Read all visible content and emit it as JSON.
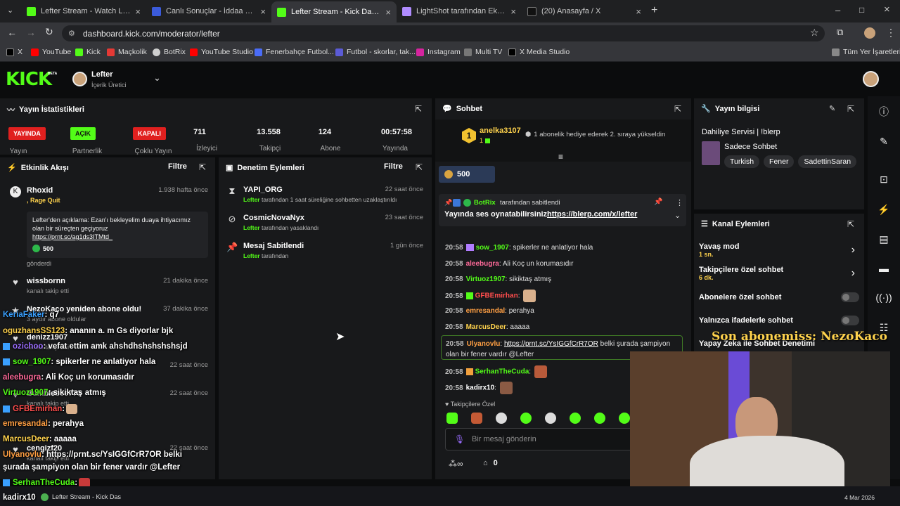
{
  "browser": {
    "tabs": [
      {
        "label": "Lefter Stream - Watch Live on Kick",
        "color": "#53fc18"
      },
      {
        "label": "Canlı Sonuçlar - İddaa Sonuçları",
        "color": "#3b5bdb"
      },
      {
        "label": "Lefter Stream - Kick Dashboard",
        "color": "#53fc18"
      },
      {
        "label": "LightShot tarafından Ekran Görüntüsü",
        "color": "#b08cff"
      },
      {
        "label": "(20) Anasayfa / X",
        "color": "#ffffff"
      }
    ],
    "url": "dashboard.kick.com/moderator/lefter",
    "bookmarks": [
      "X",
      "YouTube",
      "Kick",
      "Maçkolik",
      "BotRix",
      "YouTube Studio",
      "Fenerbahçe Futbol...",
      "Futbol - skorlar, tak...",
      "Instagram",
      "Multi TV",
      "X Media Studio"
    ],
    "all_bookmarks": "Tüm Yer İşaretleri"
  },
  "header": {
    "logo": "KICK",
    "logo_badge": "BETA",
    "user_name": "Lefter",
    "user_role": "İçerik Üretici"
  },
  "stats": {
    "title": "Yayın İstatistikleri",
    "pills": [
      {
        "label": "YAYINDA",
        "sub": "Yayın",
        "color": "#e0201f"
      },
      {
        "label": "AÇIK",
        "sub": "Partnerlik",
        "color": "#53fc18"
      },
      {
        "label": "KAPALI",
        "sub": "Çoklu Yayın",
        "color": "#e0201f"
      }
    ],
    "values": [
      {
        "value": "711",
        "label": "İzleyici"
      },
      {
        "value": "13.558",
        "label": "Takipçi"
      },
      {
        "value": "124",
        "label": "Abone"
      },
      {
        "value": "00:57:58",
        "label": "Yayında"
      }
    ]
  },
  "activity": {
    "title": "Etkinlik Akışı",
    "filter": "Filtre",
    "events": [
      {
        "name": "Rhoxid",
        "time": "1.938 hafta önce",
        "sub": ", Rage Quit",
        "message": "Lefter'den açıklama: Ezan'ı bekleyelim duaya ihtiyacımız olan bir süreçten geçiyoruz",
        "link": "https://prnt.sc/ag1ds3ITMtd_",
        "amount": "500",
        "footer": "gönderdi"
      },
      {
        "name": "wissbornn",
        "time": "21 dakika önce",
        "sub": "kanalı takip etti"
      },
      {
        "name": "NezoKaco yeniden abone oldu!",
        "time": "37 dakika önce",
        "sub": "3 aydır abone oldular"
      },
      {
        "name": "denizz1907",
        "time": "22 saat önce",
        "sub": "kanalı takip etti"
      },
      {
        "name": "Bumblebee773",
        "time": "22 saat önce",
        "sub": "kanalı takip etti"
      },
      {
        "name": "cengizf20",
        "time": "22 saat önce",
        "sub": "kanalı takip etti"
      }
    ]
  },
  "moderation": {
    "title": "Denetim Eylemleri",
    "filter": "Filtre",
    "items": [
      {
        "name": "YAPI_ORG",
        "time": "22 saat önce",
        "sub_user": "Lefter",
        "sub": "tarafından 1 saat süreliğine sohbetten uzaklaştırıldı"
      },
      {
        "name": "CosmicNovaNyx",
        "time": "23 saat önce",
        "sub_user": "Lefter",
        "sub": "tarafından yasaklandı"
      },
      {
        "name": "Mesaj Sabitlendi",
        "time": "1 gün önce",
        "sub_user": "Lefter",
        "sub": "tarafından"
      }
    ]
  },
  "chat": {
    "title": "Sohbet",
    "gift_rank": "1",
    "gift_user": "anelka3107",
    "gift_count": "1",
    "gift_text": "1 abonelik hediye ederek 2. sıraya yükseldin",
    "kicks": "500",
    "pinned_by": "BotRix",
    "pinned_label": "tarafından sabitlendi",
    "pinned_msg": "Yayında ses oynatabilirsiniz.",
    "pinned_link": "https://blerp.com/x/lefter",
    "messages": [
      {
        "time": "20:58",
        "user": "sow_1907",
        "color": "#53fc18",
        "text": "spikerler ne anlatiyor hala"
      },
      {
        "time": "20:58",
        "user": "aleebugra",
        "color": "#ff6a9a",
        "text": "Ali Koç un korumasıdır"
      },
      {
        "time": "20:58",
        "user": "Virtuoz1907",
        "color": "#53fc18",
        "text": "sikiktaş atmış"
      },
      {
        "time": "20:58",
        "user": "GFBEmirhan",
        "color": "#ff4d4d",
        "text": ""
      },
      {
        "time": "20:58",
        "user": "emresandal",
        "color": "#ff9f43",
        "text": "perahya"
      },
      {
        "time": "20:58",
        "user": "MarcusDeer",
        "color": "#ffd34d",
        "text": "aaaaa"
      },
      {
        "time": "20:58",
        "user": "Ulyanovlu",
        "color": "#ff9f43",
        "text": "belki şurada şampiyon olan bir fener vardır @Lefter",
        "link": "https://prnt.sc/YsIGGfCrR7OR"
      },
      {
        "time": "20:58",
        "user": "SerhanTheCuda",
        "color": "#53fc18",
        "text": ""
      },
      {
        "time": "20:58",
        "user": "kadirx10",
        "color": "#ffffff",
        "text": ""
      }
    ],
    "followers_only": "Takipçilere Özel",
    "input_placeholder": "Bir mesaj gönderin",
    "points": "0"
  },
  "stream_info": {
    "title": "Yayın bilgisi",
    "stream_title": "Dahiliye Servisi | !blerp",
    "category": "Sadece Sohbet",
    "tags": [
      "Turkish",
      "Fener",
      "SadettinSaran"
    ]
  },
  "channel_actions": {
    "title": "Kanal Eylemleri",
    "items": [
      {
        "label": "Yavaş mod",
        "value": "1 sn.",
        "type": "arrow"
      },
      {
        "label": "Takipçilere özel sohbet",
        "value": "6 dk.",
        "type": "arrow"
      },
      {
        "label": "Abonelere özel sohbet",
        "type": "toggle"
      },
      {
        "label": "Yalnızca ifadelerle sohbet",
        "type": "toggle"
      },
      {
        "label": "Yapay Zeka ile Sohbet Denetimi",
        "type": "link"
      }
    ]
  },
  "overlay": {
    "last_sub": "Son abonemiss: NezoKaco",
    "chat": [
      {
        "user": "KeriaFaker",
        "color": "#3aa0ff",
        "text": ": q7"
      },
      {
        "user": "oguzhansSS123",
        "color": "#ffd34d",
        "text": ": ananın a. m Gs diyorlar bjk"
      },
      {
        "user": "ozichoo",
        "color": "#9b6cff",
        "text": ": vefat ettim amk ahshdhshshshshsjd"
      },
      {
        "user": "sow_1907",
        "color": "#53fc18",
        "text": ": spikerler ne anlatiyor hala"
      },
      {
        "user": "aleebugra",
        "color": "#ff6a9a",
        "text": ": Ali Koç un korumasıdır"
      },
      {
        "user": "Virtuoz1907",
        "color": "#53fc18",
        "text": ": sikiktaş atmış"
      },
      {
        "user": "GFBEmirhan",
        "color": "#ff4d4d",
        "text": ":"
      },
      {
        "user": "emresandal",
        "color": "#ff9f43",
        "text": ": perahya"
      },
      {
        "user": "MarcusDeer",
        "color": "#ffd34d",
        "text": ": aaaaa"
      },
      {
        "user": "Ulyanovlu",
        "color": "#ff9f43",
        "text": ": https://prnt.sc/YsIGGfCrR7OR belki"
      },
      {
        "user": "",
        "color": "#ffffff",
        "text": "şurada şampiyon olan bir fener vardır @Lefter"
      },
      {
        "user": "SerhanTheCuda",
        "color": "#53fc18",
        "text": ":"
      },
      {
        "user": "kadirx10",
        "color": "#ffffff",
        "text": ""
      }
    ],
    "taskbar_title": "Lefter Stream - Kick Das",
    "date": "4 Mar 2026"
  }
}
